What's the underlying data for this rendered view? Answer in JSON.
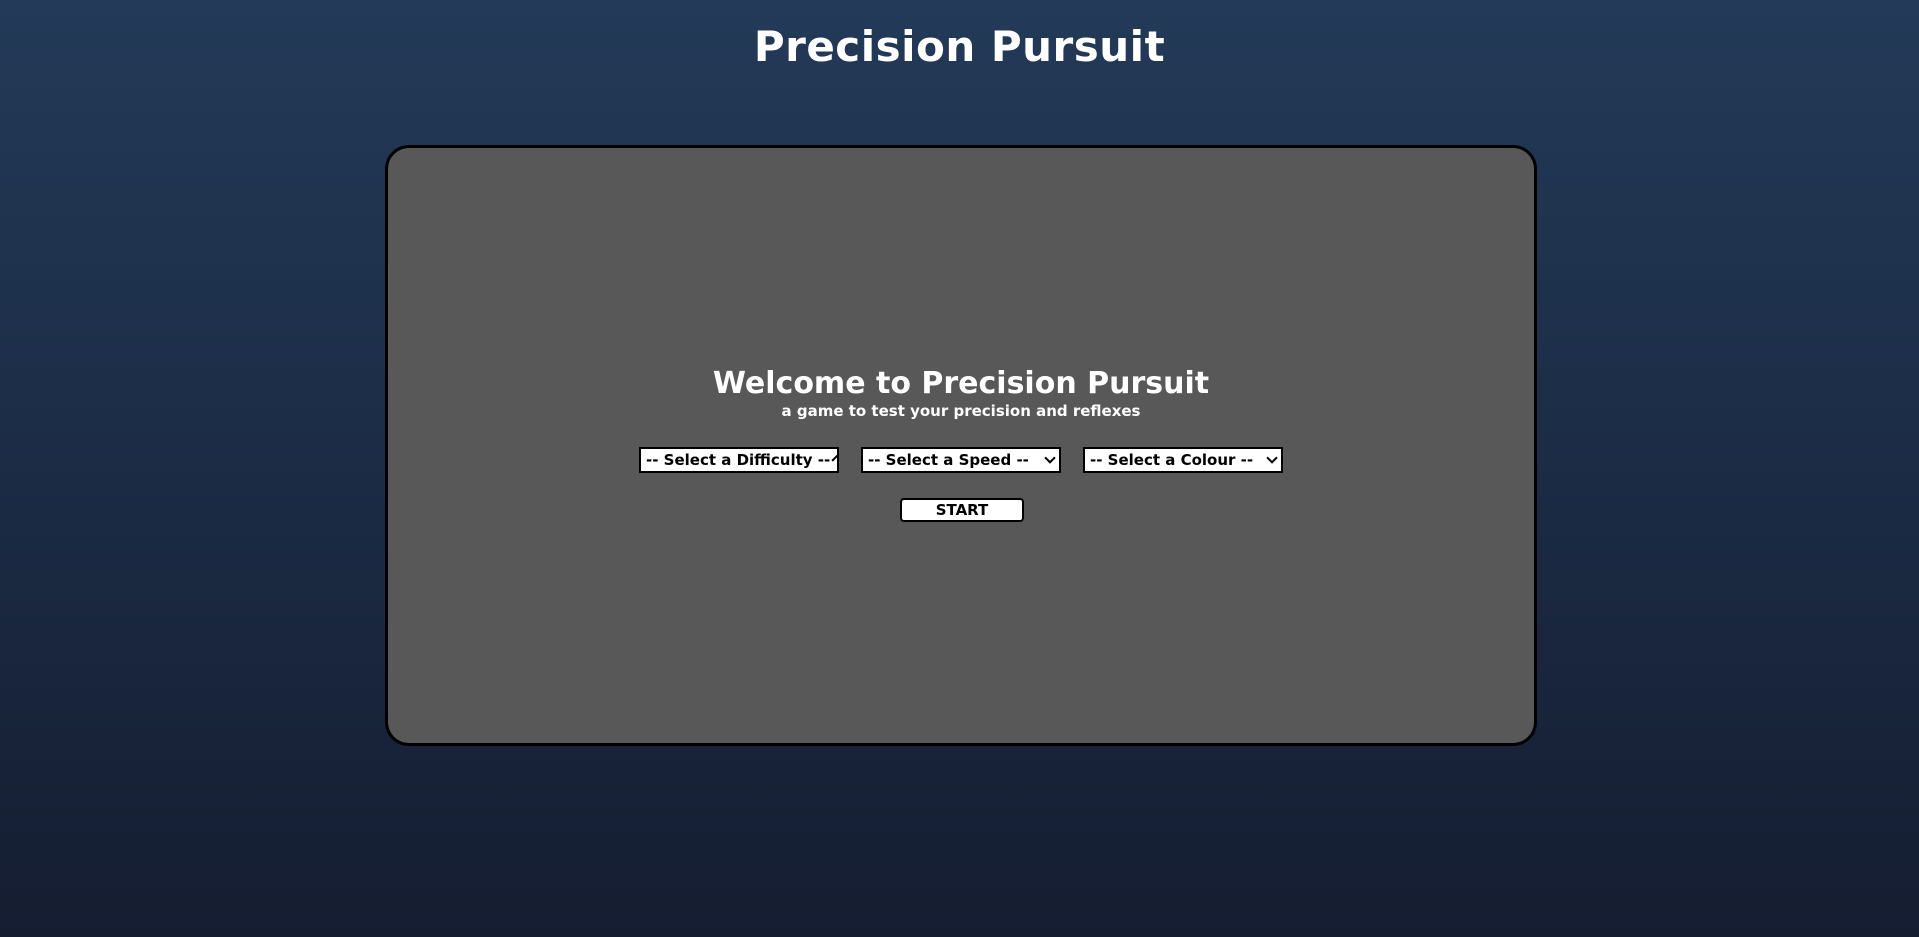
{
  "header": {
    "title": "Precision Pursuit"
  },
  "welcome": {
    "title": "Welcome to Precision Pursuit",
    "subtitle": "a game to test your precision and reflexes"
  },
  "controls": {
    "difficulty": {
      "selected": "-- Select a Difficulty --",
      "icon": "chevron-down-icon"
    },
    "speed": {
      "selected": "-- Select a Speed --",
      "icon": "chevron-down-icon"
    },
    "colour": {
      "selected": "-- Select a Colour --",
      "icon": "chevron-down-icon"
    },
    "start_label": "START"
  },
  "colors": {
    "background_top": "#233a58",
    "background_bottom": "#151d31",
    "panel": "#585858",
    "panel_border": "#000000",
    "text": "#ffffff"
  }
}
